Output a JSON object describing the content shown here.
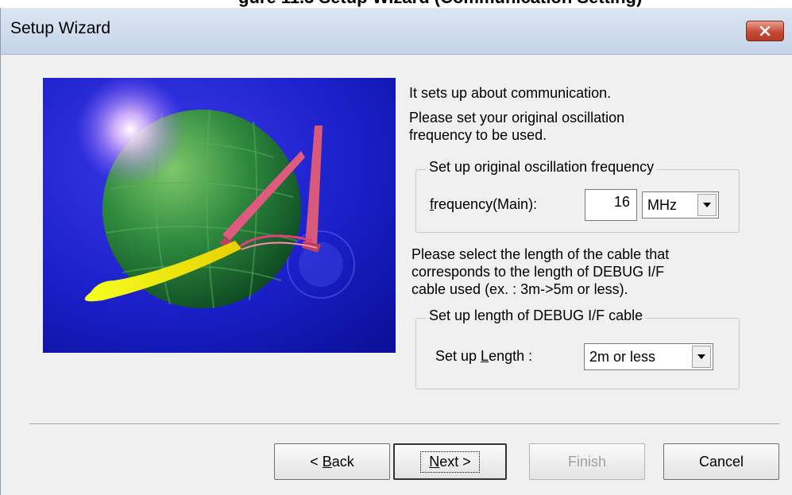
{
  "page_caption": "gure 11.3 Setup Wizard (Communication Setting)",
  "window": {
    "title": "Setup Wizard"
  },
  "intro": {
    "line1": "It sets up about communication.",
    "line2": "Please set your original oscillation",
    "line3": "frequency to be used."
  },
  "oscillation_group": {
    "legend": "Set up original oscillation frequency",
    "label_mnemonic": "f",
    "label_rest": "requency(Main):",
    "value": "16",
    "unit_value": "MHz"
  },
  "cable_text": {
    "line1": "Please select the length of the cable that",
    "line2": "corresponds to the length of DEBUG I/F",
    "line3": "cable used (ex. : 3m->5m or less)."
  },
  "cable_group": {
    "legend": "Set up length of DEBUG I/F cable",
    "label_pre": "Set up ",
    "label_mnemonic": "L",
    "label_rest": "ength :",
    "value": "2m or less"
  },
  "buttons": {
    "back_prefix": "< ",
    "back_mnemonic": "B",
    "back_rest": "ack",
    "next_mnemonic": "N",
    "next_rest": "ext >",
    "finish": "Finish",
    "cancel": "Cancel"
  },
  "colors": {
    "banner_bg": "#1a20c8",
    "close_button": "#c74a36"
  }
}
